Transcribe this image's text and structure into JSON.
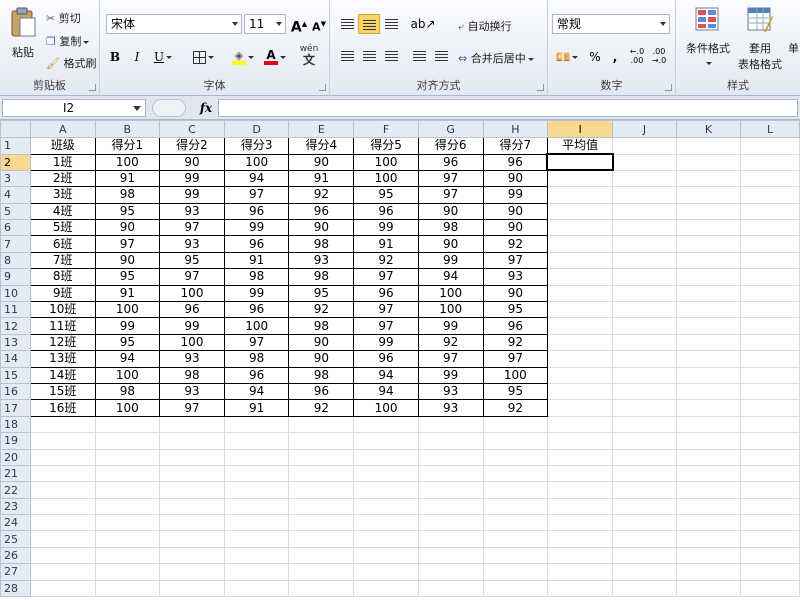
{
  "ribbon": {
    "clipboard": {
      "paste": "粘贴",
      "cut": "剪切",
      "copy": "复制",
      "format_painter": "格式刷",
      "label": "剪贴板"
    },
    "font": {
      "name": "宋体",
      "size": "11",
      "bold": "B",
      "italic": "I",
      "underline": "U",
      "grow": "A",
      "shrink": "A",
      "font_color_letter": "A",
      "label": "字体"
    },
    "alignment": {
      "wrap": "自动换行",
      "merge": "合并后居中",
      "label": "对齐方式"
    },
    "number": {
      "format": "常规",
      "percent": "%",
      "comma": ",",
      "label": "数字"
    },
    "styles": {
      "conditional": "条件格式",
      "table_format_1": "套用",
      "table_format_2": "表格格式",
      "cell_styles": "单",
      "label": "样式"
    }
  },
  "formula_bar": {
    "name_box": "I2",
    "fx": "fx",
    "value": ""
  },
  "sheet": {
    "columns": [
      "A",
      "B",
      "C",
      "D",
      "E",
      "F",
      "G",
      "H",
      "I",
      "J",
      "K",
      "L"
    ],
    "selected_column": "I",
    "selected_row": 2,
    "header_row": [
      "班级",
      "得分1",
      "得分2",
      "得分3",
      "得分4",
      "得分5",
      "得分6",
      "得分7",
      "平均值"
    ],
    "rows": [
      [
        "1班",
        "100",
        "90",
        "100",
        "90",
        "100",
        "96",
        "96"
      ],
      [
        "2班",
        "91",
        "99",
        "94",
        "91",
        "100",
        "97",
        "90"
      ],
      [
        "3班",
        "98",
        "99",
        "97",
        "92",
        "95",
        "97",
        "99"
      ],
      [
        "4班",
        "95",
        "93",
        "96",
        "96",
        "96",
        "90",
        "90"
      ],
      [
        "5班",
        "90",
        "97",
        "99",
        "90",
        "99",
        "98",
        "90"
      ],
      [
        "6班",
        "97",
        "93",
        "96",
        "98",
        "91",
        "90",
        "92"
      ],
      [
        "7班",
        "90",
        "95",
        "91",
        "93",
        "92",
        "99",
        "97"
      ],
      [
        "8班",
        "95",
        "97",
        "98",
        "98",
        "97",
        "94",
        "93"
      ],
      [
        "9班",
        "91",
        "100",
        "99",
        "95",
        "96",
        "100",
        "90"
      ],
      [
        "10班",
        "100",
        "96",
        "96",
        "92",
        "97",
        "100",
        "95"
      ],
      [
        "11班",
        "99",
        "99",
        "100",
        "98",
        "97",
        "99",
        "96"
      ],
      [
        "12班",
        "95",
        "100",
        "97",
        "90",
        "99",
        "92",
        "92"
      ],
      [
        "13班",
        "94",
        "93",
        "98",
        "90",
        "96",
        "97",
        "97"
      ],
      [
        "14班",
        "100",
        "98",
        "96",
        "98",
        "94",
        "99",
        "100"
      ],
      [
        "15班",
        "98",
        "93",
        "94",
        "96",
        "94",
        "93",
        "95"
      ],
      [
        "16班",
        "100",
        "97",
        "91",
        "92",
        "100",
        "93",
        "92"
      ]
    ],
    "total_rows": 28
  },
  "colors": {
    "selected_header": "#f9d98f",
    "header_bg": "#e4ebf5",
    "grid_line": "#dadcdd"
  }
}
